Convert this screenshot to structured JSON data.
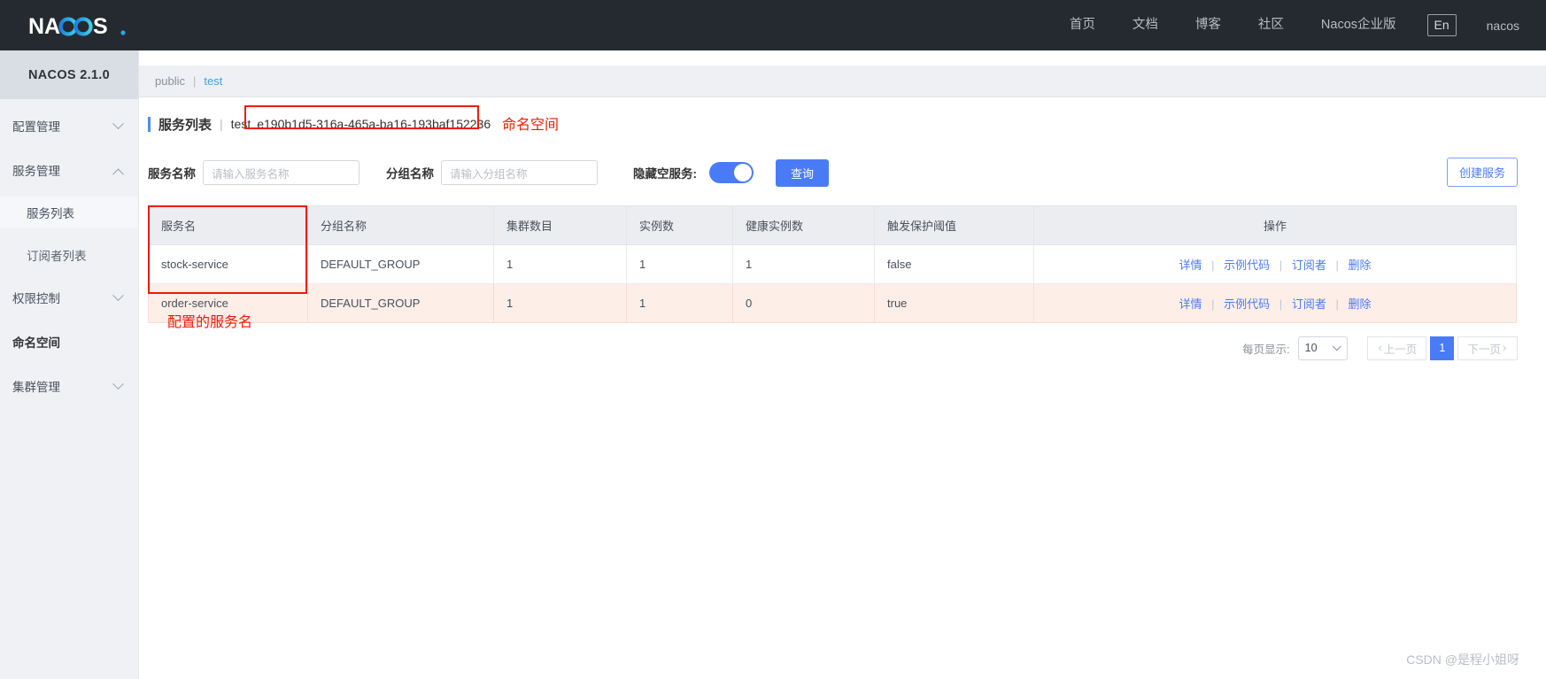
{
  "topbar": {
    "logo_text": "NACOS.",
    "nav": [
      {
        "label": "首页"
      },
      {
        "label": "文档"
      },
      {
        "label": "博客"
      },
      {
        "label": "社区"
      },
      {
        "label": "Nacos企业版"
      }
    ],
    "language_button": "En",
    "username": "nacos"
  },
  "sidebar": {
    "title": "NACOS 2.1.0",
    "items": [
      {
        "label": "配置管理",
        "type": "group",
        "expanded": false
      },
      {
        "label": "服务管理",
        "type": "group",
        "expanded": true
      },
      {
        "label": "服务列表",
        "type": "child",
        "active": true
      },
      {
        "label": "订阅者列表",
        "type": "child",
        "active": false
      },
      {
        "label": "权限控制",
        "type": "group",
        "expanded": false
      },
      {
        "label": "命名空间",
        "type": "plain"
      },
      {
        "label": "集群管理",
        "type": "group",
        "expanded": false
      }
    ]
  },
  "breadcrumb": {
    "public": "public",
    "separator": "|",
    "active": "test"
  },
  "page": {
    "title": "服务列表",
    "separator": "|",
    "namespace_name": "test",
    "namespace_id": "e190b1d5-316a-465a-ba16-193baf152236"
  },
  "annotations": {
    "namespace": "命名空间",
    "service_name": "配置的服务名"
  },
  "filters": {
    "service_label": "服务名称",
    "service_placeholder": "请输入服务名称",
    "service_value": "",
    "group_label": "分组名称",
    "group_placeholder": "请输入分组名称",
    "group_value": "",
    "hide_empty_label": "隐藏空服务:",
    "hide_empty_on": true,
    "query_button": "查询",
    "create_button": "创建服务"
  },
  "table": {
    "columns": [
      "服务名",
      "分组名称",
      "集群数目",
      "实例数",
      "健康实例数",
      "触发保护阈值",
      "操作"
    ],
    "rows": [
      {
        "service": "stock-service",
        "group": "DEFAULT_GROUP",
        "clusters": "1",
        "instances": "1",
        "healthy": "1",
        "threshold": "false",
        "warn": false
      },
      {
        "service": "order-service",
        "group": "DEFAULT_GROUP",
        "clusters": "1",
        "instances": "1",
        "healthy": "0",
        "threshold": "true",
        "warn": true
      }
    ],
    "actions": [
      "详情",
      "示例代码",
      "订阅者",
      "删除"
    ],
    "action_separator": "|"
  },
  "pagination": {
    "per_page_label": "每页显示:",
    "per_page_value": "10",
    "prev": "上一页",
    "current": "1",
    "next": "下一页"
  },
  "watermark": "CSDN @是程小姐呀",
  "colors": {
    "accent_blue": "#4a7bf7",
    "link_blue": "#3ba4e0",
    "annotation_red": "#f01b00",
    "topbar_bg": "#252a30",
    "warn_row_bg": "#fdeee8"
  }
}
